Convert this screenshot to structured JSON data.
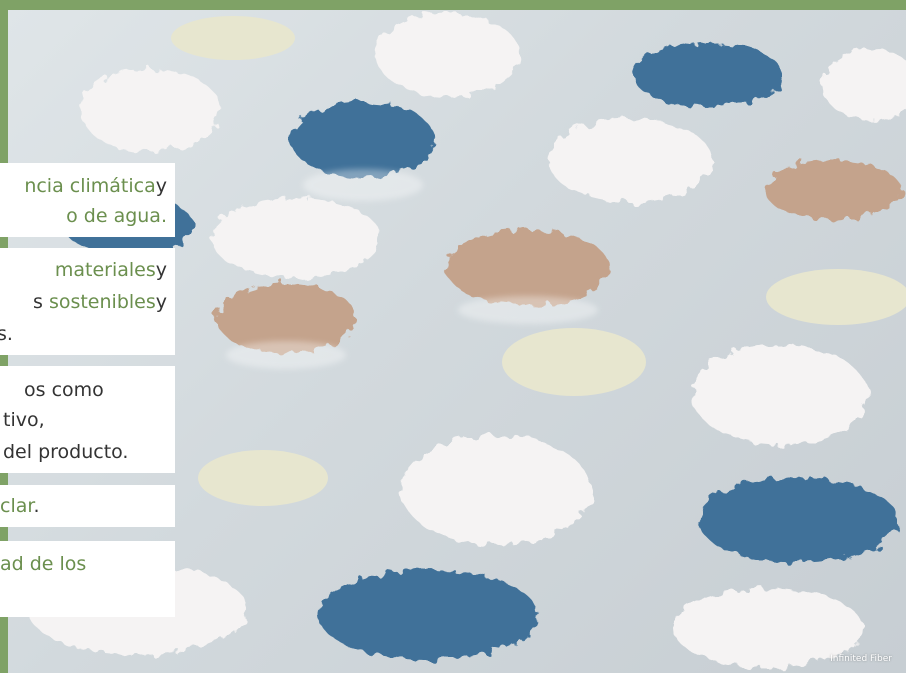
{
  "cards": [
    {
      "lines": [
        {
          "parts": [
            {
              "text": "ncia climática",
              "style": "green"
            },
            {
              "text": "y",
              "style": "dark"
            }
          ]
        },
        {
          "parts": [
            {
              "text": "o de agua.",
              "style": "green"
            }
          ]
        }
      ]
    },
    {
      "lines": [
        {
          "parts": [
            {
              "text": "materiales",
              "style": "green"
            },
            {
              "text": "y",
              "style": "dark"
            }
          ]
        },
        {
          "parts": [
            {
              "text": "s ",
              "style": "dark"
            },
            {
              "text": "sostenibles",
              "style": "green"
            },
            {
              "text": "y",
              "style": "dark"
            }
          ]
        },
        {
          "parts": [
            {
              "text": "s.",
              "style": "dark"
            }
          ]
        }
      ]
    },
    {
      "lines": [
        {
          "parts": [
            {
              "text": "os como",
              "style": "dark"
            }
          ]
        },
        {
          "parts": [
            {
              "text": "tivo,",
              "style": "dark"
            }
          ]
        },
        {
          "parts": [
            {
              "text": "del producto.",
              "style": "dark"
            }
          ]
        }
      ]
    },
    {
      "lines": [
        {
          "parts": [
            {
              "text": "clar",
              "style": "green"
            },
            {
              "text": ".",
              "style": "dark"
            }
          ]
        }
      ]
    },
    {
      "lines": [
        {
          "parts": [
            {
              "text": "ad de los",
              "style": "green"
            }
          ]
        }
      ]
    }
  ],
  "photo": {
    "credit": "Infinited Fiber",
    "colors": {
      "frame": "#7fa266",
      "background": "#d6dde1",
      "blue_fiber": "#3f7199",
      "white_fiber": "#f4f2f2",
      "tan_fiber": "#c4a38c",
      "cream_pulp": "#e7e6cf"
    }
  }
}
